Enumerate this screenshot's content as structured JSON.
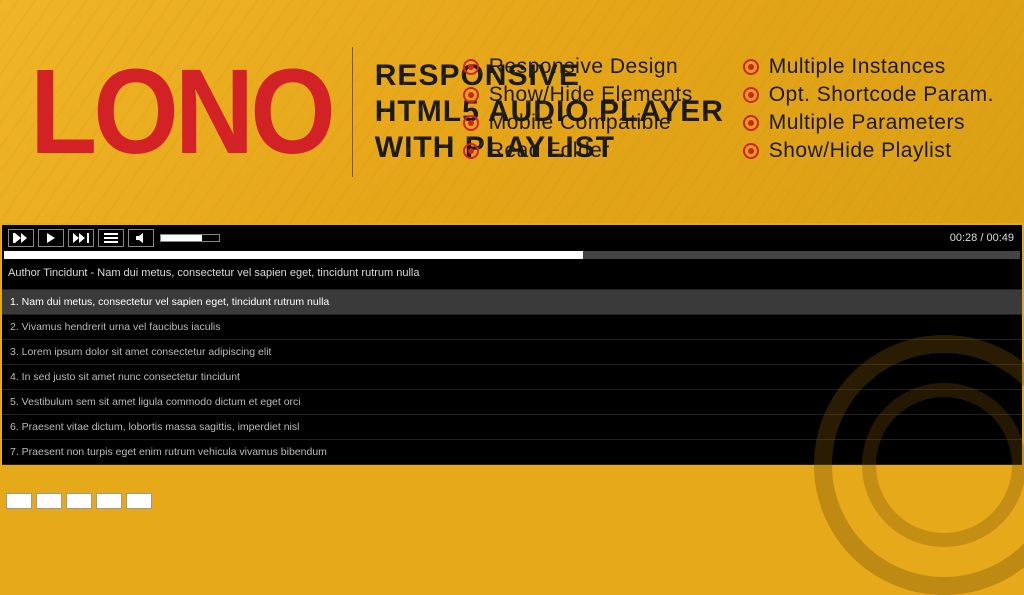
{
  "banner": {
    "logo": "LONO",
    "tagline": {
      "line1": "RESPONSIVE",
      "line2": "HTML5 AUDIO PLAYER",
      "line3": "WITH PLAYLIST"
    },
    "features": {
      "col1": [
        "Responsive Design",
        "Show/Hide Elements",
        "Mobile Compatible",
        "Read Folder"
      ],
      "col2": [
        "Multiple Instances",
        "Opt. Shortcode Param.",
        "Multiple Parameters",
        "Show/Hide Playlist"
      ]
    }
  },
  "player": {
    "time_current": "00:28",
    "time_total": "00:49",
    "time_display": "00:28 / 00:49",
    "now_playing": "Author Tincidunt - Nam dui metus, consectetur vel sapien eget, tincidunt rutrum nulla",
    "playlist": [
      "1. Nam dui metus, consectetur vel sapien eget, tincidunt rutrum nulla",
      "2. Vivamus hendrerit urna vel faucibus iaculis",
      "3. Lorem ipsum dolor sit amet consectetur adipiscing elit",
      "4. In sed justo sit amet nunc consectetur tincidunt",
      "5. Vestibulum sem sit amet ligula commodo dictum et eget orci",
      "6. Praesent vitae dictum, lobortis massa sagittis, imperdiet nisl",
      "7. Praesent non turpis eget enim rutrum vehicula vivamus bibendum"
    ],
    "active_track_index": 0
  }
}
